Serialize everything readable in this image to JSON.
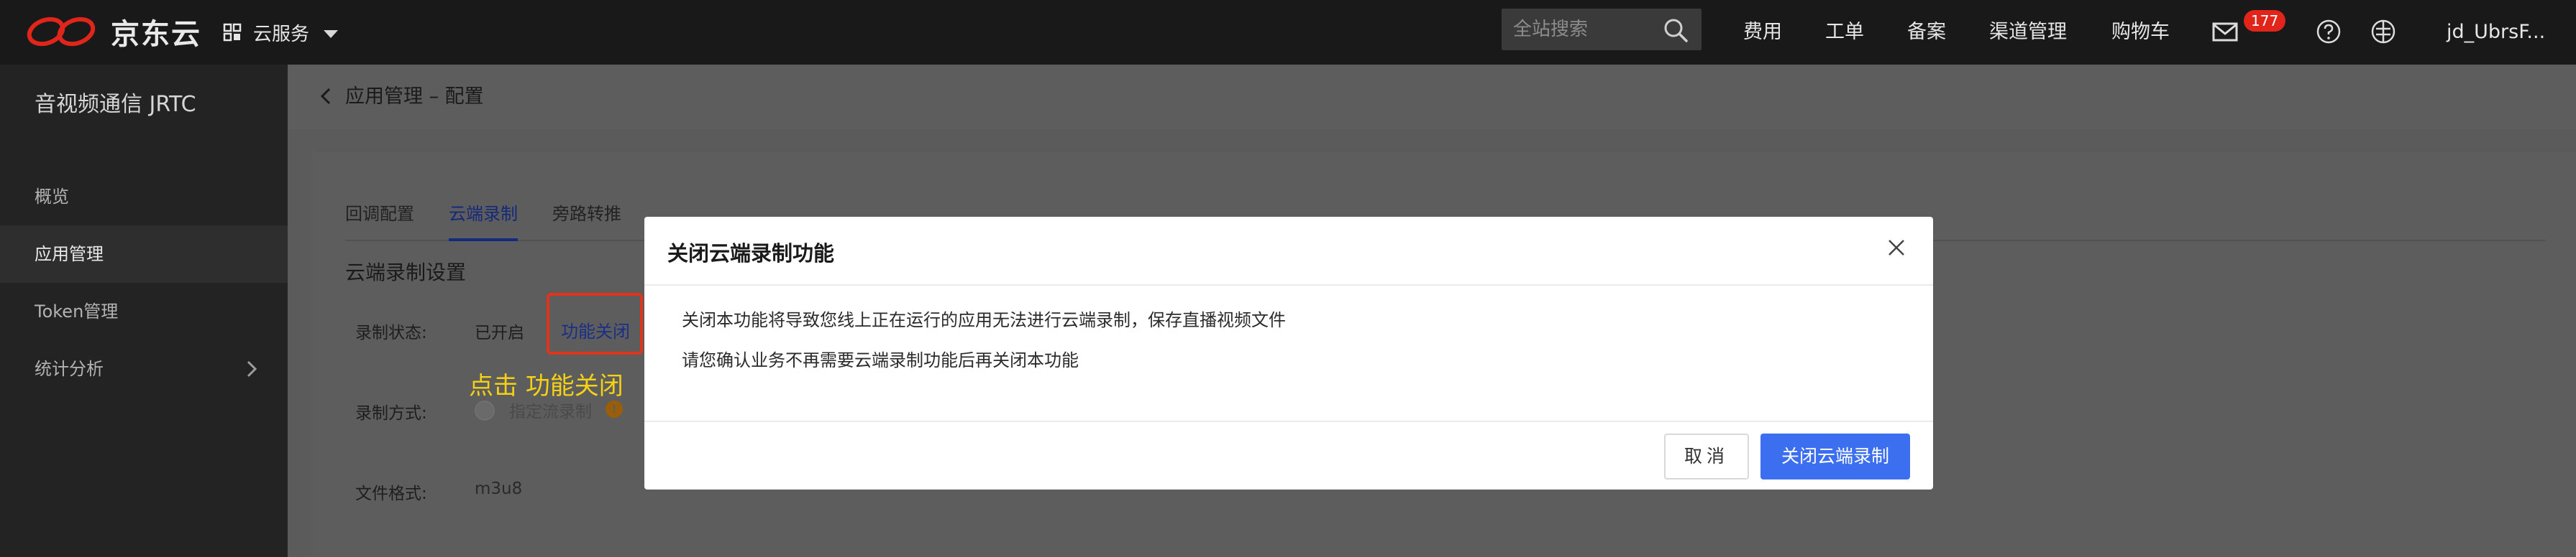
{
  "topbar": {
    "logo_text": "京东云",
    "service_menu": "云服务",
    "search_placeholder": "全站搜索",
    "nav": [
      "费用",
      "工单",
      "备案",
      "渠道管理",
      "购物车"
    ],
    "mail_badge": "177",
    "user": "jd_UbrsF..."
  },
  "sidebar": {
    "title": "音视频通信 JRTC",
    "items": [
      {
        "label": "概览"
      },
      {
        "label": "应用管理"
      },
      {
        "label": "Token管理"
      },
      {
        "label": "统计分析"
      }
    ]
  },
  "page": {
    "title": "应用管理 – 配置",
    "tabs": [
      "回调配置",
      "云端录制",
      "旁路转推"
    ],
    "section_title": "云端录制设置",
    "fields": {
      "status_label": "录制状态:",
      "status_value": "已开启",
      "close_link": "功能关闭",
      "method_label": "录制方式:",
      "method_option": "指定流录制",
      "format_label": "文件格式:",
      "format_value": "m3u8"
    },
    "hint": "点击 功能关闭"
  },
  "modal": {
    "title": "关闭云端录制功能",
    "line1": "关闭本功能将导致您线上正在运行的应用无法进行云端录制，保存直播视频文件",
    "line2": "请您确认业务不再需要云端录制功能后再关闭本功能",
    "cancel_label": "取消",
    "confirm_label": "关闭云端录制"
  },
  "colors": {
    "topbar_bg": "#191919",
    "sidebar_bg": "#232323",
    "primary_button": "#3c6ff0",
    "brand_red": "#e1251b",
    "annotation_red": "#e2341d",
    "annotation_yellow": "#f5d116"
  },
  "icons": [
    "jdcloud-logo-icon",
    "grid-icon",
    "chevron-down-icon",
    "search-icon",
    "mail-icon",
    "help-icon",
    "globe-icon",
    "chevron-right-icon",
    "chevron-left-icon",
    "close-icon",
    "info-icon"
  ]
}
